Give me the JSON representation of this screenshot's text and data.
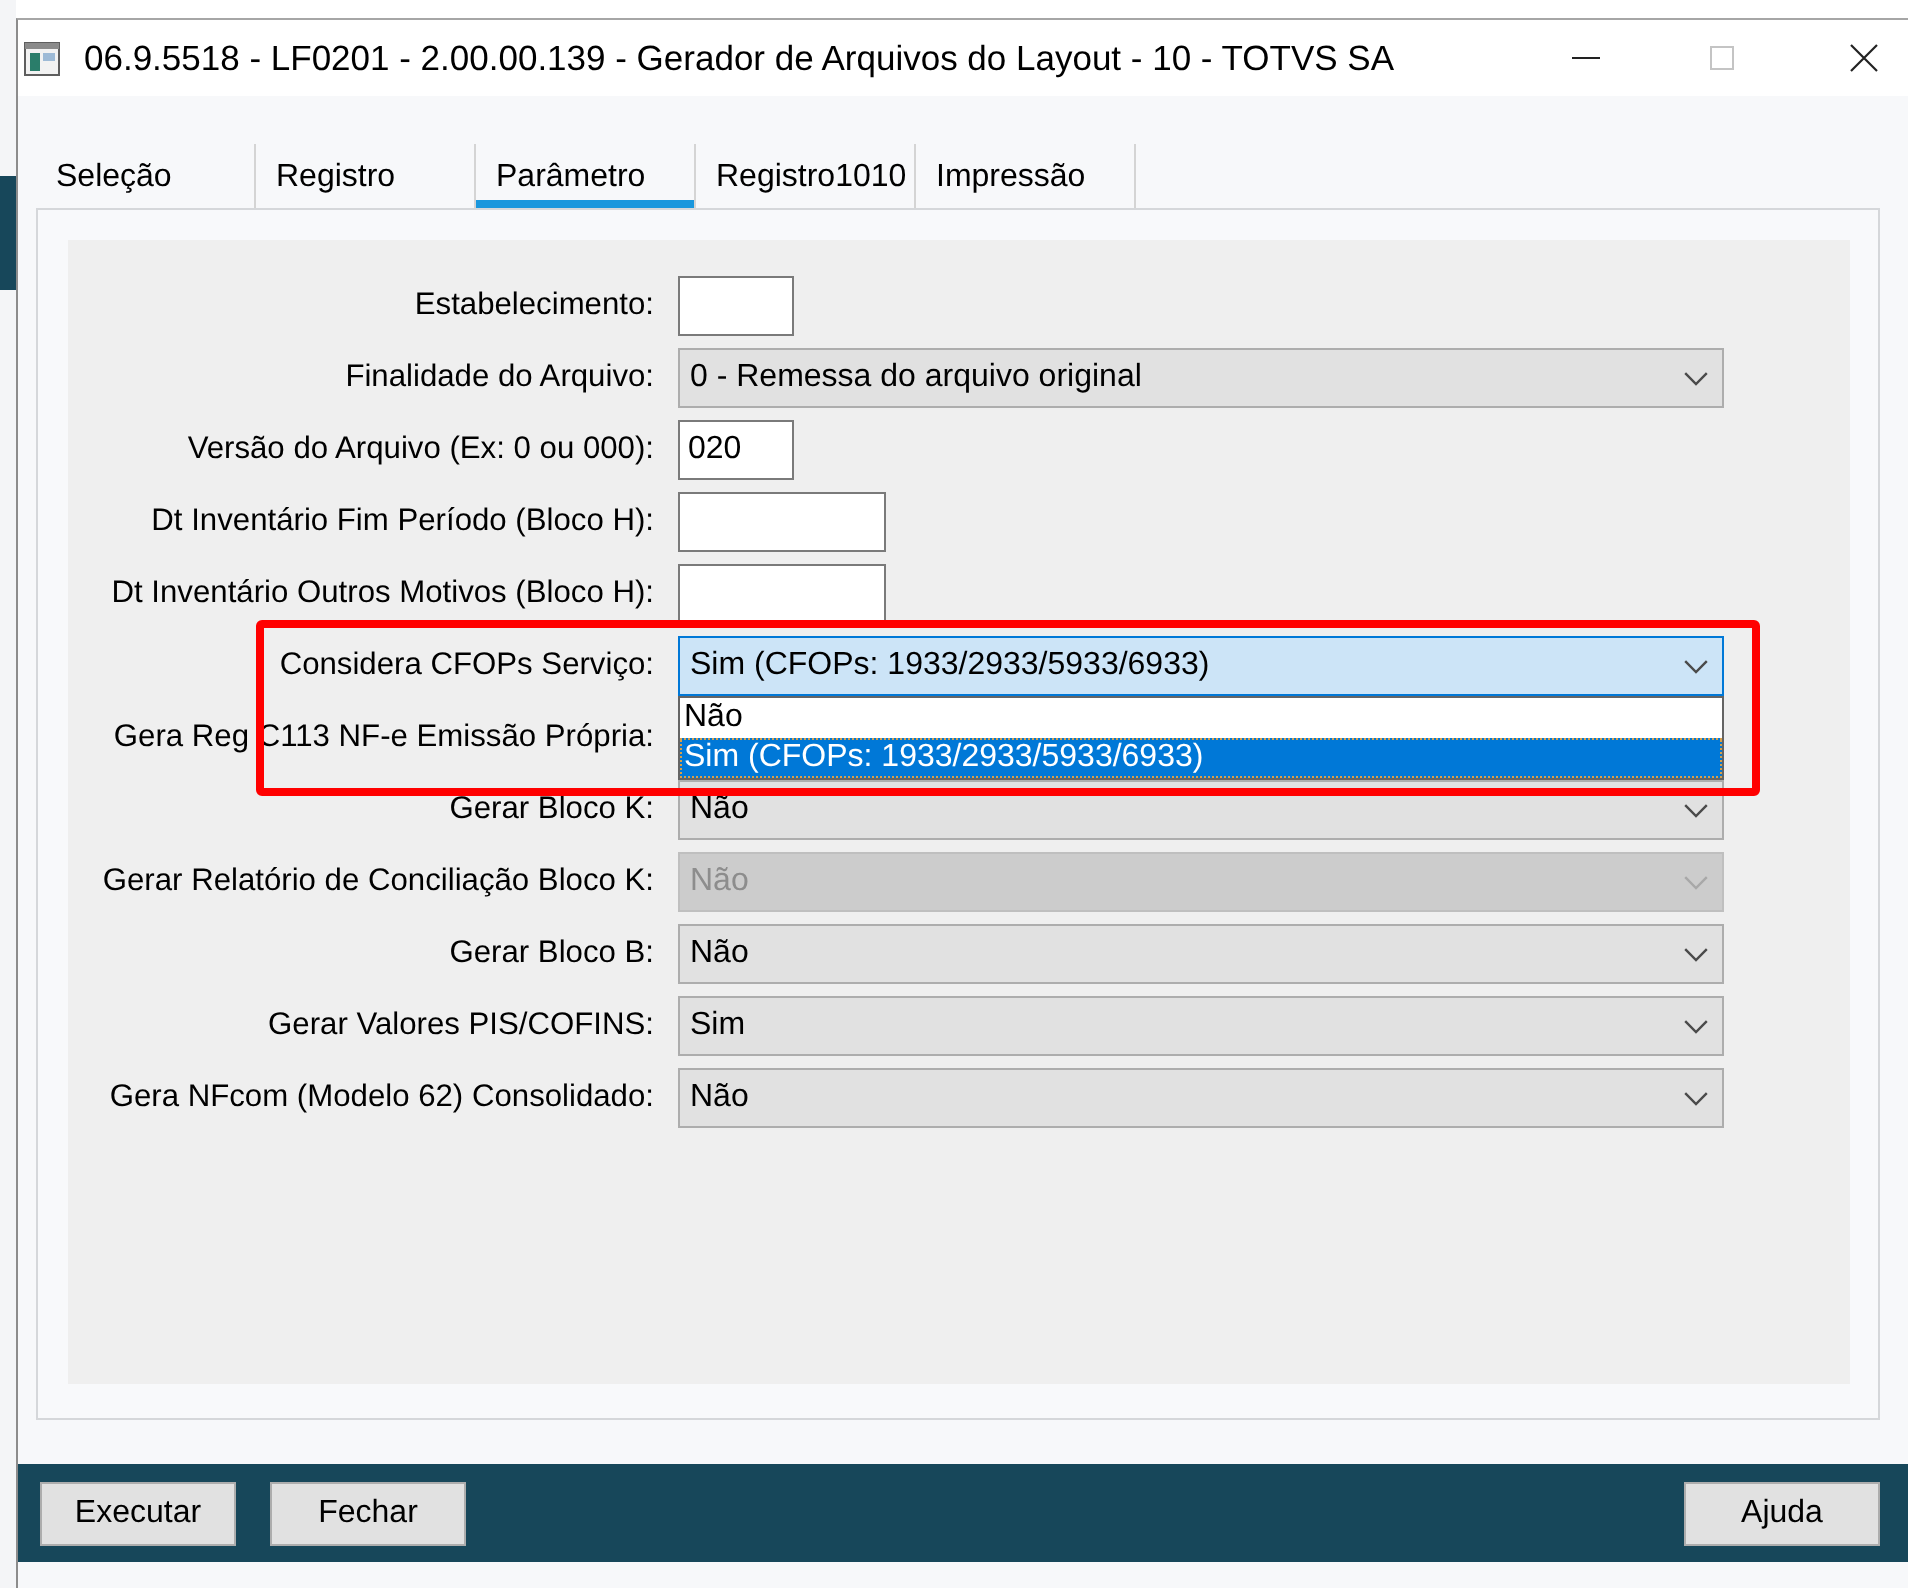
{
  "window": {
    "title": "06.9.5518 - LF0201 - 2.00.00.139 - Gerador de Arquivos do Layout - 10 - TOTVS SA",
    "maximizable": false
  },
  "tabs": [
    {
      "label": "Seleção",
      "selected": false
    },
    {
      "label": "Registro",
      "selected": false
    },
    {
      "label": "Parâmetro",
      "selected": true
    },
    {
      "label": "Registro1010",
      "selected": false
    },
    {
      "label": "Impressão",
      "selected": false
    }
  ],
  "fields": [
    {
      "label": "Estabelecimento:",
      "kind": "text",
      "highlighted": false
    },
    {
      "label": "Finalidade do Arquivo:",
      "kind": "select",
      "value": "0 - Remessa do arquivo original",
      "disabled": false,
      "expanded": false,
      "highlighted": false
    },
    {
      "label": "Versão do Arquivo (Ex: 0 ou 000):",
      "kind": "text",
      "value": "020",
      "highlighted": false
    },
    {
      "label": "Dt Inventário Fim Período (Bloco H):",
      "kind": "date",
      "highlighted": false
    },
    {
      "label": "Dt Inventário Outros Motivos (Bloco H):",
      "kind": "date",
      "highlighted": false
    },
    {
      "label": "Considera CFOPs Serviço:",
      "kind": "select",
      "value": "Sim (CFOPs: 1933/2933/5933/6933)",
      "disabled": false,
      "expanded": true,
      "highlighted": true,
      "options": [
        {
          "label": "Não",
          "selected": false
        },
        {
          "label": "Sim (CFOPs: 1933/2933/5933/6933)",
          "selected": true
        }
      ]
    },
    {
      "label": "Gera Reg C113 NF-e Emissão Própria:",
      "kind": "select",
      "highlighted": false
    },
    {
      "label": "Gerar Bloco K:",
      "kind": "select",
      "value": "Não",
      "disabled": false,
      "expanded": false,
      "highlighted": false
    },
    {
      "label": "Gerar Relatório de Conciliação Bloco K:",
      "kind": "select",
      "value": "Não",
      "disabled": true,
      "expanded": false,
      "highlighted": false
    },
    {
      "label": "Gerar Bloco B:",
      "kind": "select",
      "value": "Não",
      "disabled": false,
      "expanded": false,
      "highlighted": false
    },
    {
      "label": "Gerar Valores PIS/COFINS:",
      "kind": "select",
      "value": "Sim",
      "disabled": false,
      "expanded": false,
      "highlighted": false
    },
    {
      "label": "Gera NFcom (Modelo 62) Consolidado:",
      "kind": "select",
      "value": "Não",
      "disabled": false,
      "expanded": false,
      "highlighted": false
    }
  ],
  "left_buttons": [
    "Executar",
    "Fechar"
  ],
  "right_buttons": [
    "Ajuda"
  ]
}
